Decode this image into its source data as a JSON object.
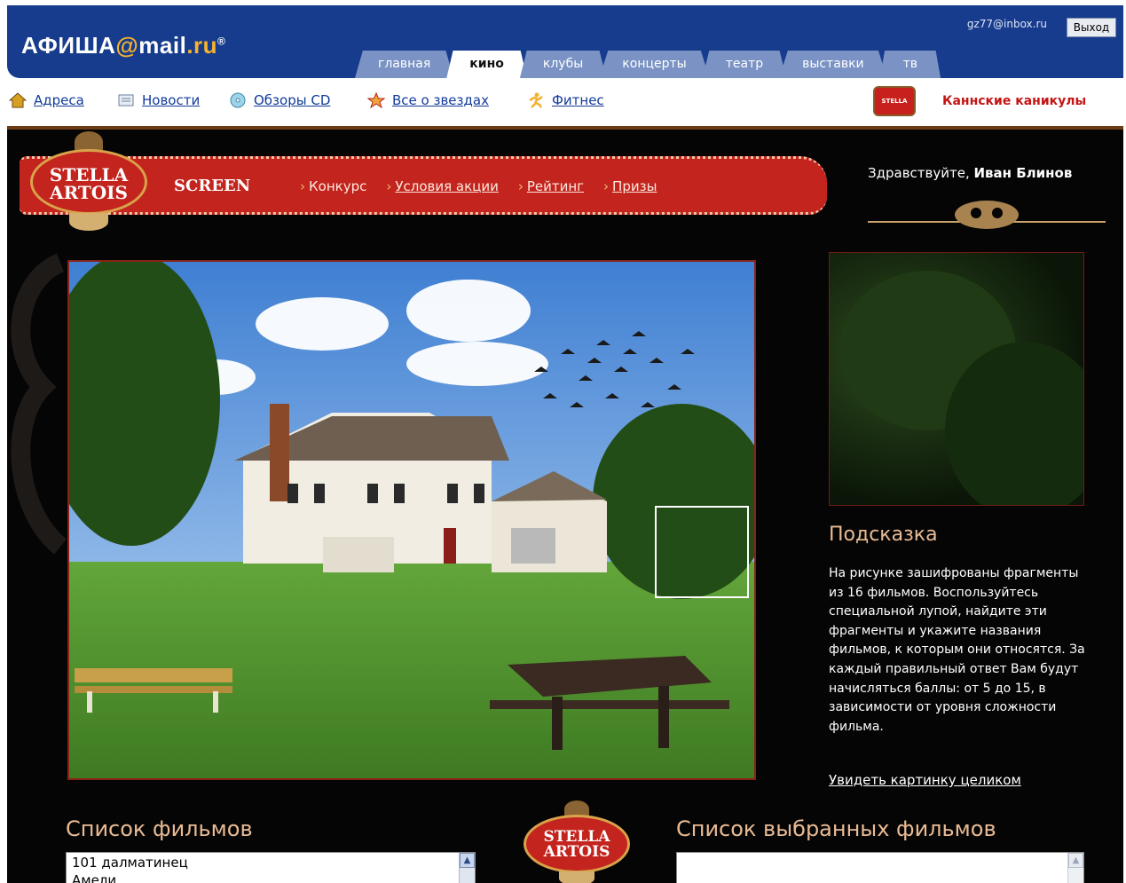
{
  "header": {
    "logo_text_1": "АФИША",
    "logo_at": "@",
    "logo_text_2": "mail",
    "logo_dot": ".",
    "logo_text_3": "ru",
    "logo_reg": "®",
    "user_email": "gz77@inbox.ru",
    "logout_label": "Выход",
    "tabs": [
      {
        "label": "главная",
        "active": false
      },
      {
        "label": "кино",
        "active": true
      },
      {
        "label": "клубы",
        "active": false
      },
      {
        "label": "концерты",
        "active": false
      },
      {
        "label": "театр",
        "active": false
      },
      {
        "label": "выставки",
        "active": false
      },
      {
        "label": "тв",
        "active": false
      }
    ]
  },
  "subnav": {
    "items": [
      {
        "label": "Адреса",
        "icon": "house-icon"
      },
      {
        "label": "Новости",
        "icon": "newspaper-icon"
      },
      {
        "label": "Обзоры CD",
        "icon": "cd-icon"
      },
      {
        "label": "Все о звездах",
        "icon": "star-icon"
      },
      {
        "label": "Фитнес",
        "icon": "runner-icon"
      }
    ],
    "promo_badge": "STELLA ARTOIS",
    "promo_label": "Каннские каникулы"
  },
  "promo_header": {
    "brand_line_1": "STELLA",
    "brand_line_2": "ARTOIS",
    "screen_label": "SCREEN",
    "nav": [
      {
        "label": "Конкурс",
        "link": false
      },
      {
        "label": "Условия акции",
        "link": true
      },
      {
        "label": "Рейтинг",
        "link": true
      },
      {
        "label": "Призы",
        "link": true
      }
    ],
    "greeting_prefix": "Здравствуйте, ",
    "greeting_name": "Иван Блинов"
  },
  "hint": {
    "title": "Подсказка",
    "text": "На рисунке зашифрованы фрагменты из 16 фильмов. Воспользуйтесь специальной лупой, найдите эти фрагменты и укажите названия фильмов, к которым они относятся. За каждый правильный ответ Вам будут начисляться баллы: от 5 до 15, в зависимости от уровня сложности фильма.",
    "see_all_link": "Увидеть картинку целиком"
  },
  "film_list": {
    "title": "Список фильмов",
    "items": [
      "101 далматинец",
      "Амели"
    ]
  },
  "selected_list": {
    "title": "Список выбранных фильмов",
    "items": []
  },
  "mid_logo": {
    "line_1": "STELLA",
    "line_2": "ARTOIS"
  },
  "colors": {
    "header_blue": "#173c8d",
    "tab_inactive": "#7a93c4",
    "ribbon_red": "#c3241e",
    "accent_gold": "#e9bb94",
    "link_blue": "#123b9a",
    "promo_red": "#c41414"
  }
}
